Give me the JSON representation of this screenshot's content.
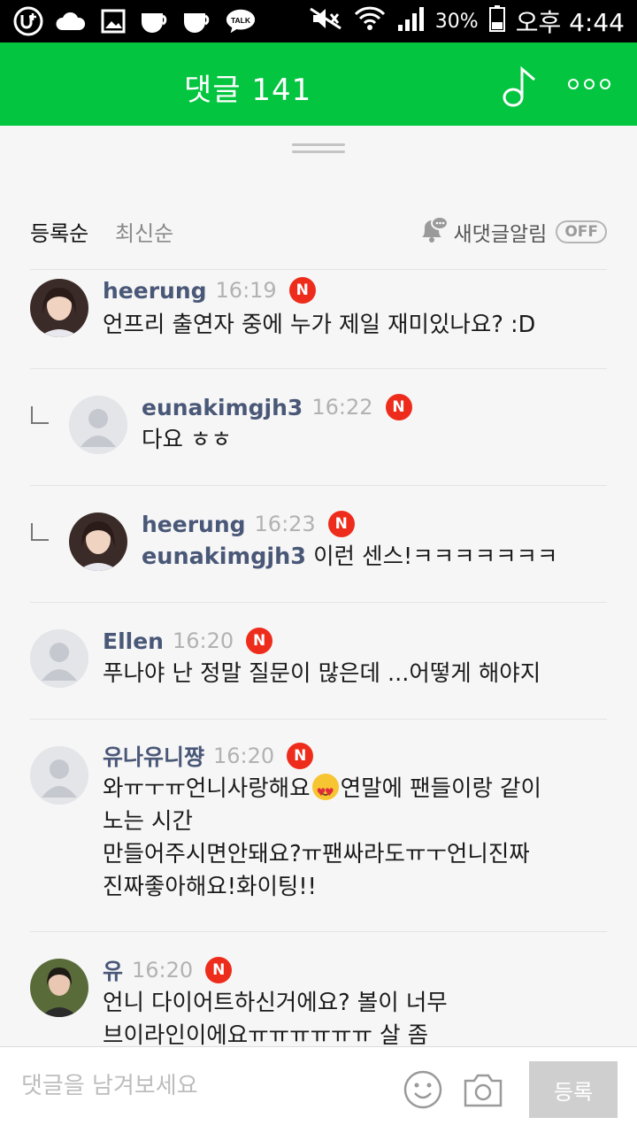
{
  "status_bar": {
    "left_icons": [
      "u-plus-icon",
      "cloud-icon",
      "gallery-icon",
      "cup-icon",
      "cup-icon",
      "kakaotalk-icon"
    ],
    "battery_percent": "30%",
    "time": "오후 4:44"
  },
  "header": {
    "title": "댓글 141"
  },
  "sort": {
    "tab_registered": "등록순",
    "tab_latest": "최신순",
    "notify_label": "새댓글알림",
    "notify_toggle": "OFF"
  },
  "comments": [
    {
      "nick": "heerung",
      "time": "16:19",
      "badge": "N",
      "lines": [
        "언프리 출연자 중에 누가 제일 재미있나요? :D"
      ]
    },
    {
      "nick": "eunakimgjh3",
      "time": "16:22",
      "badge": "N",
      "reply": true,
      "lines": [
        "다요 ㅎㅎ"
      ]
    },
    {
      "nick": "heerung",
      "time": "16:23",
      "badge": "N",
      "reply": true,
      "mention": "eunakimgjh3",
      "text": "이런 센스!ㅋㅋㅋㅋㅋㅋㅋ"
    },
    {
      "nick": "Ellen",
      "time": "16:20",
      "badge": "N",
      "lines": [
        "푸나야 난 정말 질문이 많은데 ...어떻게 해야지"
      ]
    },
    {
      "nick": "유나유니쨩",
      "time": "16:20",
      "badge": "N",
      "line1a": "와ㅠㅜㅠ언니사랑해요",
      "line1b": "연말에 팬들이랑 같이",
      "lines": [
        "노는 시간",
        "만들어주시면안돼요?ㅠ팬싸라도ㅠㅜ언니진짜",
        "진짜좋아해요!화이팅!!"
      ]
    },
    {
      "nick": "유",
      "time": "16:20",
      "badge": "N",
      "lines": [
        "언니 다이어트하신거에요? 볼이 너무",
        "브이라인이에요ㅠㅠㅠㅠㅠㅠ 살 좀"
      ]
    }
  ],
  "input": {
    "placeholder": "댓글을 남겨보세요",
    "submit_label": "등록"
  }
}
